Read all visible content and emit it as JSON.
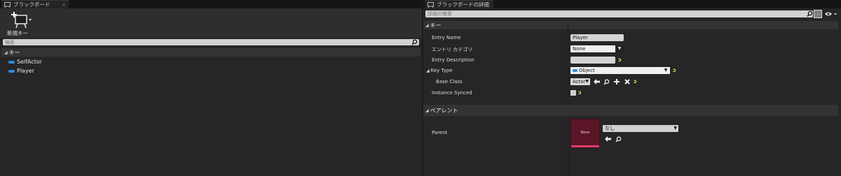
{
  "left_panel": {
    "tab_title": "ブラックボード",
    "tab_close": "×",
    "new_key_label": "新規キー",
    "search_placeholder": "検索",
    "section_title": "キー",
    "keys": [
      {
        "name": "SelfActor",
        "icon": "object-pill-icon"
      },
      {
        "name": "Player",
        "icon": "object-pill-icon"
      }
    ]
  },
  "right_panel": {
    "tab_title": "ブラックボードの詳細",
    "search_placeholder": "詳細の検索",
    "section_key": "キー",
    "entry_name_label": "Entry Name",
    "entry_name_value": "Player",
    "entry_category_label": "エントリ カテゴリ",
    "entry_category_value": "None",
    "entry_description_label": "Entry Description",
    "entry_description_value": "",
    "key_type_label": "Key Type",
    "key_type_value": "Object",
    "base_class_label": "Base Class",
    "base_class_value": "Actor",
    "instance_synced_label": "Instance Synced",
    "section_parent": "ペアレント",
    "parent_label": "Parent",
    "parent_thumb_text": "None",
    "parent_dropdown_value": "なし",
    "reset_glyph": "ↄ"
  },
  "colors": {
    "object_pin": "#2d8ce0",
    "reset_arrow": "#e8d94a",
    "parent_thumb": "#5a1626",
    "parent_thumb_bar": "#e03c6e"
  }
}
